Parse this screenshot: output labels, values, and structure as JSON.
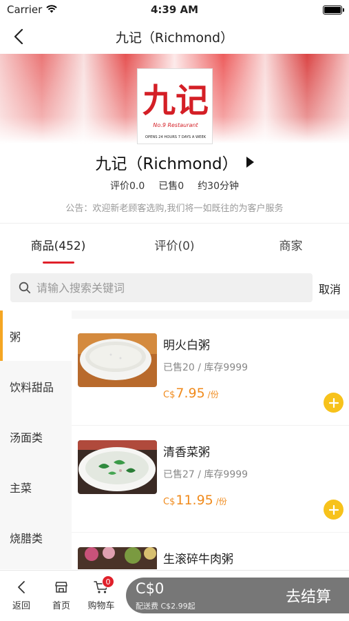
{
  "status_bar": {
    "carrier": "Carrier",
    "time": "4:39 AM"
  },
  "nav": {
    "title": "九记（Richmond）"
  },
  "shop": {
    "name": "九记（Richmond）",
    "logo_text": {
      "main": "九记",
      "sub": "No.9 Restaurant",
      "hours": "OPENS 24 HOURS 7 DAYS A WEEK"
    },
    "rating": "评价0.0",
    "sold": "已售0",
    "delivery_time": "约30分钟",
    "notice": "公告：欢迎新老顾客选购,我们将一如既往的为客户服务"
  },
  "tabs": [
    {
      "label": "商品(452)"
    },
    {
      "label": "评价(0)"
    },
    {
      "label": "商家"
    }
  ],
  "search": {
    "placeholder": "请输入搜索关键词",
    "cancel_label": "取消"
  },
  "categories": [
    {
      "label": "粥"
    },
    {
      "label": "饮料甜品"
    },
    {
      "label": "汤面类"
    },
    {
      "label": "主菜"
    },
    {
      "label": "烧腊类"
    }
  ],
  "products": [
    {
      "name": "明火白粥",
      "meta": "已售20 / 库存9999",
      "currency": "C$",
      "price": "7.95",
      "unit": "/份"
    },
    {
      "name": "清香菜粥",
      "meta": "已售27 / 库存9999",
      "currency": "C$",
      "price": "11.95",
      "unit": "/份"
    },
    {
      "name": "生滚碎牛肉粥",
      "meta": "",
      "currency": "",
      "price": "",
      "unit": ""
    }
  ],
  "bottom_nav": {
    "back_label": "返回",
    "home_label": "首页",
    "cart_label": "购物车",
    "cart_count": "0"
  },
  "checkout": {
    "total": "C$0",
    "delivery_fee": "配送费 C$2.99起",
    "button_label": "去结算"
  },
  "colors": {
    "accent_red": "#e0202a",
    "price_orange": "#f08b1d",
    "add_yellow": "#f7c21b",
    "active_category": "#f5a623"
  }
}
